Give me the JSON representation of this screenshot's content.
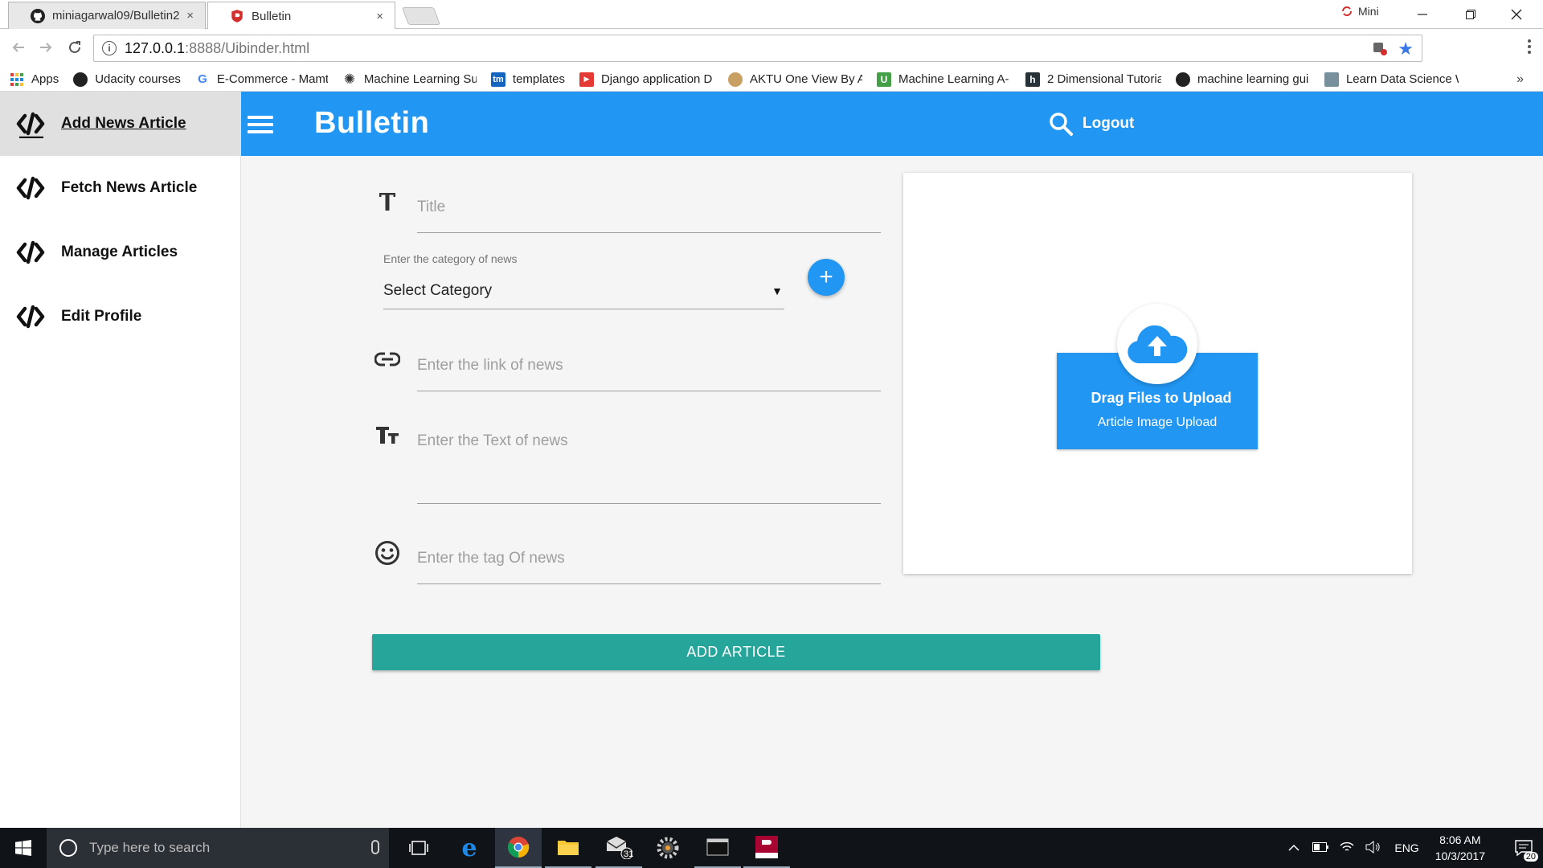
{
  "browser": {
    "tabs": [
      {
        "title": "miniagarwal09/Bulletin2",
        "icon": "github-icon",
        "active": false
      },
      {
        "title": "Bulletin",
        "icon": "bulletin-favicon",
        "active": true
      }
    ],
    "close_glyph": "×",
    "profile_name": "Mini",
    "url_host": "127.0.0.1",
    "url_path": ":8888/Uibinder.html",
    "bookmarks": [
      {
        "label": "Apps",
        "icon": "apps-grid-icon"
      },
      {
        "label": "Udacity courses",
        "icon": "github-icon"
      },
      {
        "label": "E-Commerce - Mamt",
        "icon": "google-icon"
      },
      {
        "label": "Machine Learning Su",
        "icon": "gear-icon"
      },
      {
        "label": "templates",
        "icon": "tm-icon"
      },
      {
        "label": "Django application D",
        "icon": "youtube-icon"
      },
      {
        "label": "AKTU One View By A",
        "icon": "aktu-icon"
      },
      {
        "label": "Machine Learning A-",
        "icon": "udemy-icon"
      },
      {
        "label": "2 Dimensional Tutoria",
        "icon": "h-icon"
      },
      {
        "label": "machine learning gui",
        "icon": "github-icon"
      },
      {
        "label": "Learn Data Science W",
        "icon": "datascience-icon"
      }
    ],
    "more_glyph": "»"
  },
  "sidebar": {
    "items": [
      {
        "label": "Add News Article",
        "active": true
      },
      {
        "label": "Fetch News Article",
        "active": false
      },
      {
        "label": "Manage Articles",
        "active": false
      },
      {
        "label": "Edit Profile",
        "active": false
      }
    ]
  },
  "header": {
    "brand": "Bulletin",
    "logout_label": "Logout",
    "color": "#2196f3"
  },
  "form": {
    "title_placeholder": "Title",
    "category_label": "Enter the category of news",
    "category_value": "Select Category",
    "add_category_glyph": "+",
    "link_placeholder": "Enter the link of news",
    "text_placeholder": "Enter the Text of news",
    "tag_placeholder": "Enter the tag Of news",
    "submit_label": "ADD ARTICLE",
    "submit_color": "#26a69a"
  },
  "upload": {
    "drag_label": "Drag Files to Upload",
    "sub_label": "Article Image Upload"
  },
  "taskbar": {
    "search_placeholder": "Type here to search",
    "lang": "ENG",
    "time": "8:06 AM",
    "date": "10/3/2017",
    "notif_count": "20",
    "mail_badge": "31"
  }
}
